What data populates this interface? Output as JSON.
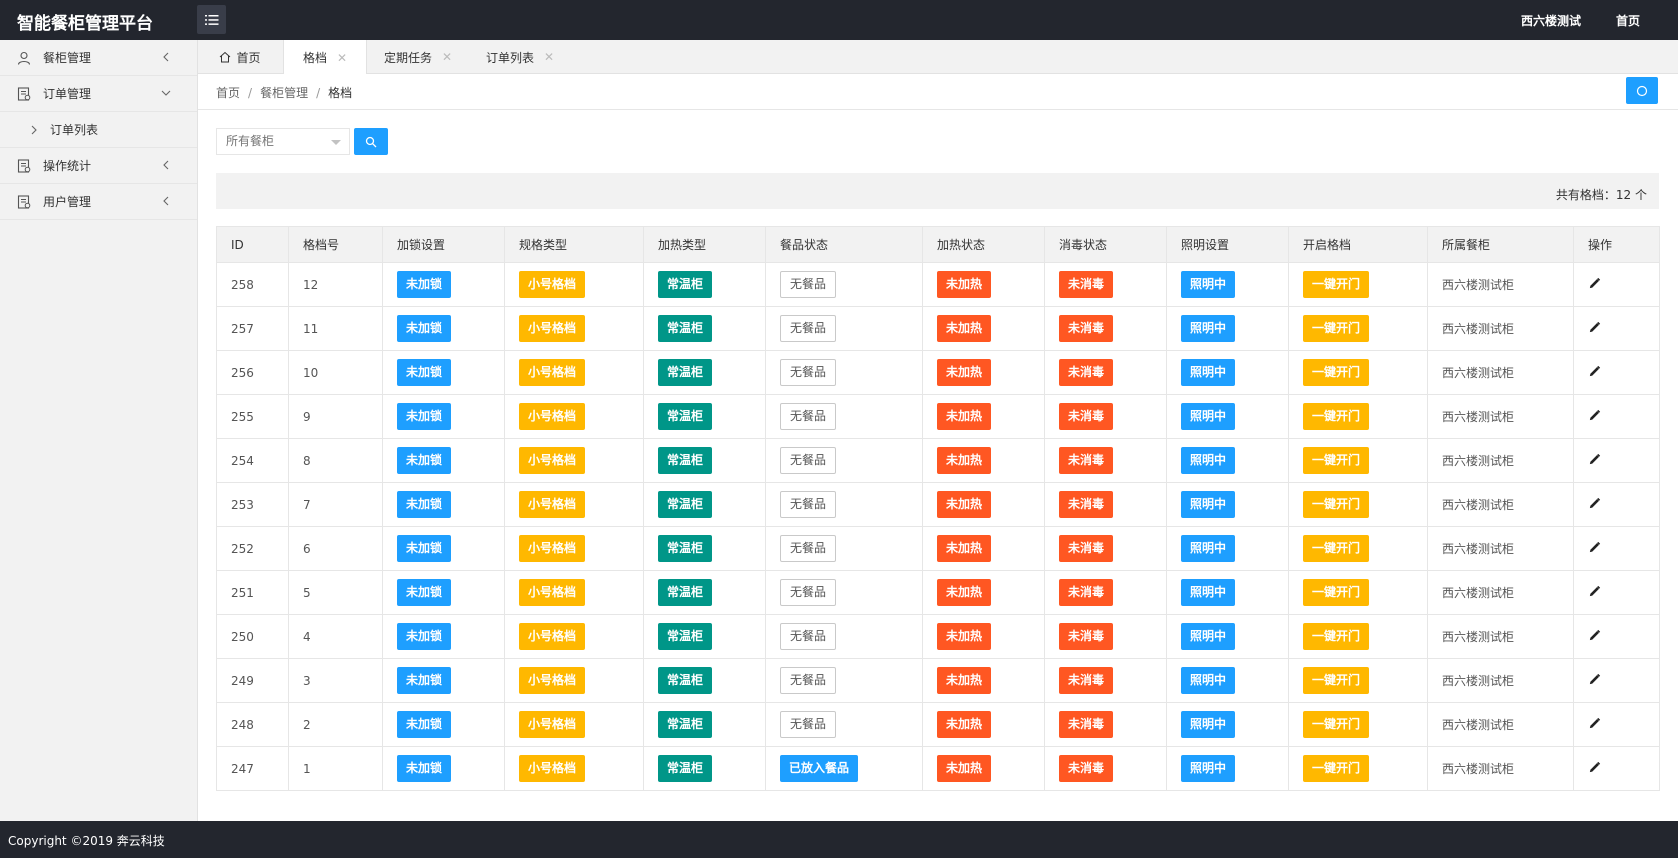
{
  "app": {
    "title": "智能餐柜管理平台"
  },
  "header": {
    "user": "西六楼测试",
    "home_link": "首页"
  },
  "sidebar": {
    "items": [
      {
        "label": "餐柜管理",
        "icon": "user-icon",
        "expanded": false
      },
      {
        "label": "订单管理",
        "icon": "document-icon",
        "expanded": true,
        "children": [
          {
            "label": "订单列表"
          }
        ]
      },
      {
        "label": "操作统计",
        "icon": "document-icon",
        "expanded": false
      },
      {
        "label": "用户管理",
        "icon": "document-icon",
        "expanded": false
      }
    ]
  },
  "tabs": [
    {
      "label": "首页",
      "icon": "home-icon",
      "closable": false
    },
    {
      "label": "格档",
      "closable": true,
      "active": true
    },
    {
      "label": "定期任务",
      "closable": true
    },
    {
      "label": "订单列表",
      "closable": true
    }
  ],
  "breadcrumb": {
    "items": [
      "首页",
      "餐柜管理",
      "格档"
    ]
  },
  "filter": {
    "select_value": "所有餐柜"
  },
  "summary": {
    "text": "共有格档：12 个"
  },
  "table": {
    "headers": [
      "ID",
      "格档号",
      "加锁设置",
      "规格类型",
      "加热类型",
      "餐品状态",
      "加热状态",
      "消毒状态",
      "照明设置",
      "开启格档",
      "所属餐柜",
      "操作"
    ],
    "rows": [
      {
        "id": "258",
        "no": "12",
        "lock": "未加锁",
        "spec": "小号格档",
        "heat_type": "常温柜",
        "food": "无餐品",
        "food_filled": false,
        "heat": "未加热",
        "disinfect": "未消毒",
        "light": "照明中",
        "open": "一键开门",
        "cabinet": "西六楼测试柜"
      },
      {
        "id": "257",
        "no": "11",
        "lock": "未加锁",
        "spec": "小号格档",
        "heat_type": "常温柜",
        "food": "无餐品",
        "food_filled": false,
        "heat": "未加热",
        "disinfect": "未消毒",
        "light": "照明中",
        "open": "一键开门",
        "cabinet": "西六楼测试柜"
      },
      {
        "id": "256",
        "no": "10",
        "lock": "未加锁",
        "spec": "小号格档",
        "heat_type": "常温柜",
        "food": "无餐品",
        "food_filled": false,
        "heat": "未加热",
        "disinfect": "未消毒",
        "light": "照明中",
        "open": "一键开门",
        "cabinet": "西六楼测试柜"
      },
      {
        "id": "255",
        "no": "9",
        "lock": "未加锁",
        "spec": "小号格档",
        "heat_type": "常温柜",
        "food": "无餐品",
        "food_filled": false,
        "heat": "未加热",
        "disinfect": "未消毒",
        "light": "照明中",
        "open": "一键开门",
        "cabinet": "西六楼测试柜"
      },
      {
        "id": "254",
        "no": "8",
        "lock": "未加锁",
        "spec": "小号格档",
        "heat_type": "常温柜",
        "food": "无餐品",
        "food_filled": false,
        "heat": "未加热",
        "disinfect": "未消毒",
        "light": "照明中",
        "open": "一键开门",
        "cabinet": "西六楼测试柜"
      },
      {
        "id": "253",
        "no": "7",
        "lock": "未加锁",
        "spec": "小号格档",
        "heat_type": "常温柜",
        "food": "无餐品",
        "food_filled": false,
        "heat": "未加热",
        "disinfect": "未消毒",
        "light": "照明中",
        "open": "一键开门",
        "cabinet": "西六楼测试柜"
      },
      {
        "id": "252",
        "no": "6",
        "lock": "未加锁",
        "spec": "小号格档",
        "heat_type": "常温柜",
        "food": "无餐品",
        "food_filled": false,
        "heat": "未加热",
        "disinfect": "未消毒",
        "light": "照明中",
        "open": "一键开门",
        "cabinet": "西六楼测试柜"
      },
      {
        "id": "251",
        "no": "5",
        "lock": "未加锁",
        "spec": "小号格档",
        "heat_type": "常温柜",
        "food": "无餐品",
        "food_filled": false,
        "heat": "未加热",
        "disinfect": "未消毒",
        "light": "照明中",
        "open": "一键开门",
        "cabinet": "西六楼测试柜"
      },
      {
        "id": "250",
        "no": "4",
        "lock": "未加锁",
        "spec": "小号格档",
        "heat_type": "常温柜",
        "food": "无餐品",
        "food_filled": false,
        "heat": "未加热",
        "disinfect": "未消毒",
        "light": "照明中",
        "open": "一键开门",
        "cabinet": "西六楼测试柜"
      },
      {
        "id": "249",
        "no": "3",
        "lock": "未加锁",
        "spec": "小号格档",
        "heat_type": "常温柜",
        "food": "无餐品",
        "food_filled": false,
        "heat": "未加热",
        "disinfect": "未消毒",
        "light": "照明中",
        "open": "一键开门",
        "cabinet": "西六楼测试柜"
      },
      {
        "id": "248",
        "no": "2",
        "lock": "未加锁",
        "spec": "小号格档",
        "heat_type": "常温柜",
        "food": "无餐品",
        "food_filled": false,
        "heat": "未加热",
        "disinfect": "未消毒",
        "light": "照明中",
        "open": "一键开门",
        "cabinet": "西六楼测试柜"
      },
      {
        "id": "247",
        "no": "1",
        "lock": "未加锁",
        "spec": "小号格档",
        "heat_type": "常温柜",
        "food": "已放入餐品",
        "food_filled": true,
        "heat": "未加热",
        "disinfect": "未消毒",
        "light": "照明中",
        "open": "一键开门",
        "cabinet": "西六楼测试柜"
      }
    ]
  },
  "footer": {
    "copyright": "Copyright ©2019 奔云科技"
  },
  "colors": {
    "header_bg": "#23262e",
    "blue": "#1e9fff",
    "orange": "#ffb800",
    "green": "#009688",
    "red": "#ff5722"
  }
}
